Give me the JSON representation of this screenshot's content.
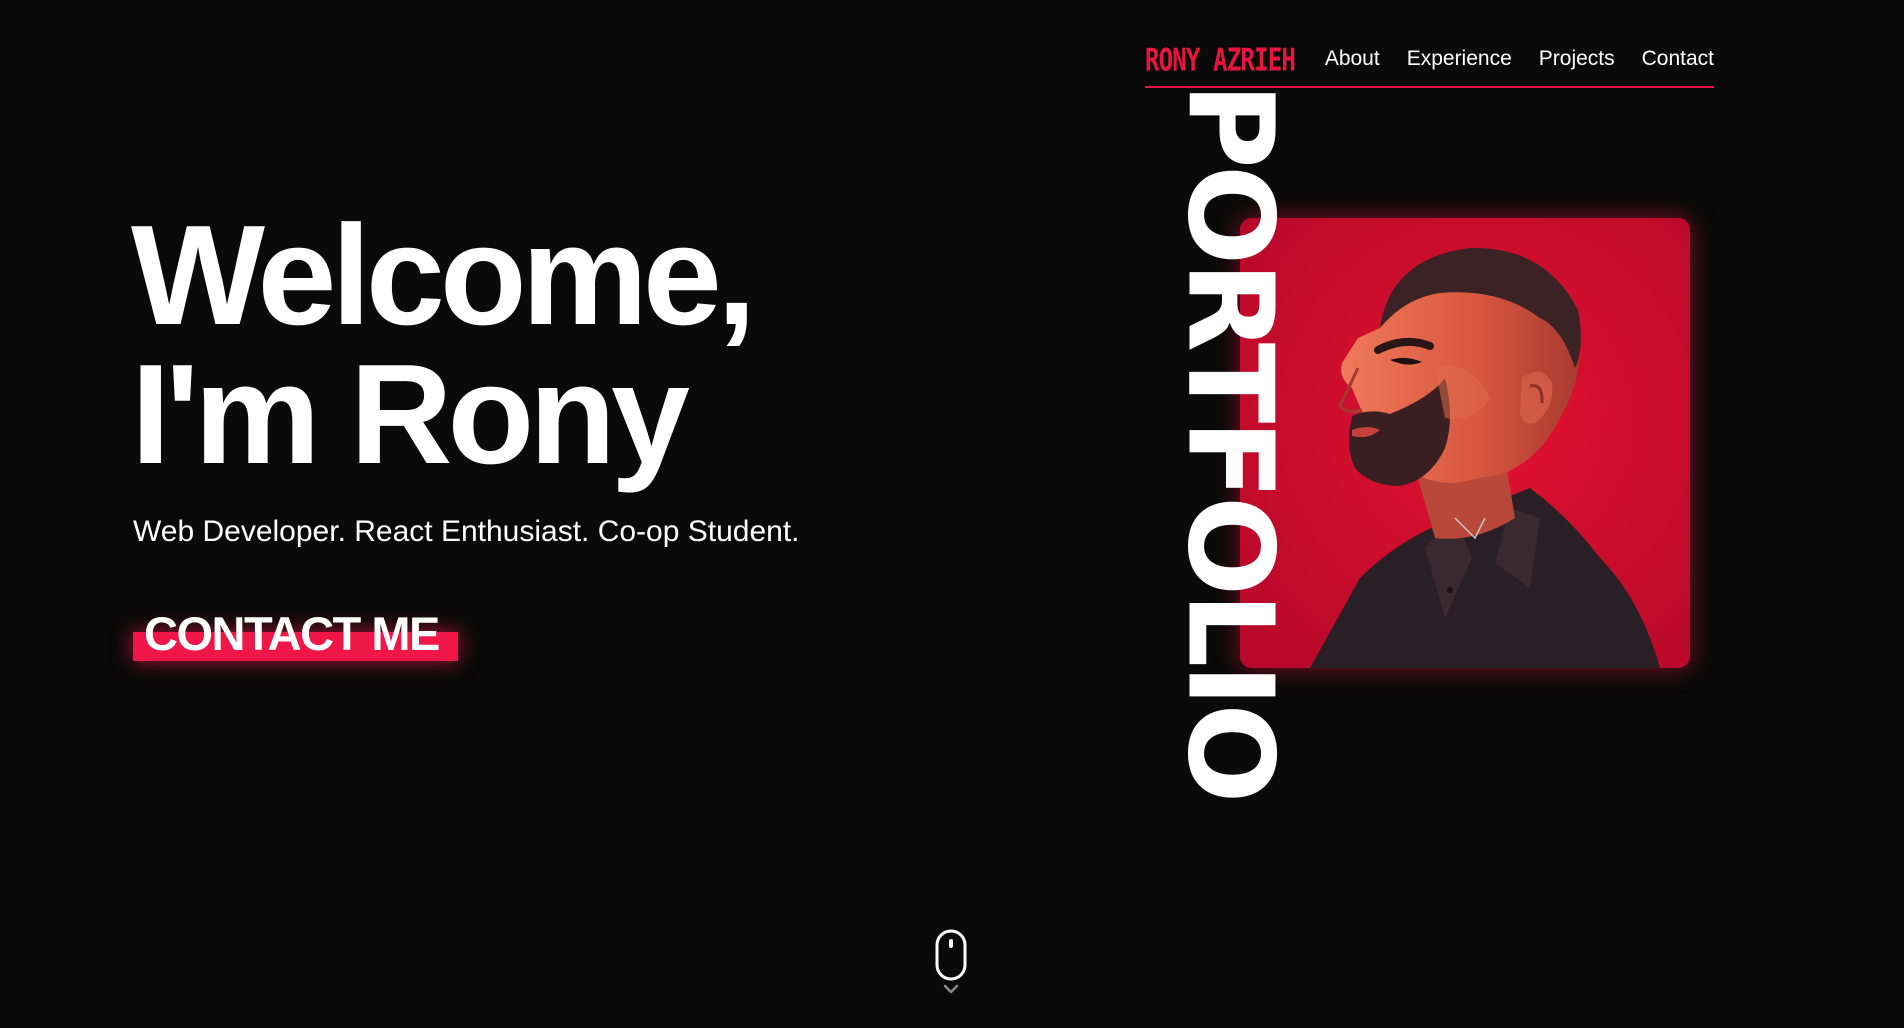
{
  "nav": {
    "logo": "RONY AZRIEH",
    "links": [
      {
        "label": "About"
      },
      {
        "label": "Experience"
      },
      {
        "label": "Projects"
      },
      {
        "label": "Contact"
      }
    ]
  },
  "hero": {
    "title_line1": "Welcome,",
    "title_line2": "I'm Rony",
    "subtitle": "Web Developer. React Enthusiast. Co-op Student.",
    "cta_label": "CONTACT ME"
  },
  "portrait": {
    "vertical_word": "PORTFOLIO"
  },
  "colors": {
    "accent": "#ee1748",
    "background": "#0a0a0a",
    "text": "#ffffff",
    "card": "#d60d2c"
  },
  "icons": {
    "scroll": "mouse-scroll-icon",
    "chevron": "chevron-down-icon"
  }
}
